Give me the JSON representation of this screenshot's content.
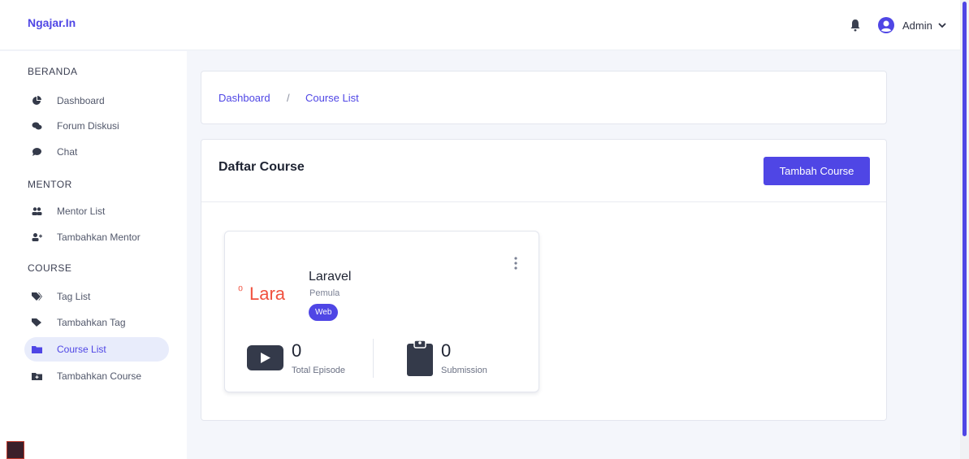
{
  "app": {
    "brand": "Ngajar.In"
  },
  "header": {
    "user_label": "Admin"
  },
  "sidebar": {
    "sections": [
      {
        "title": "BERANDA",
        "items": [
          {
            "label": "Dashboard",
            "icon": "chart-pie-icon"
          },
          {
            "label": "Forum Diskusi",
            "icon": "comments-icon"
          },
          {
            "label": "Chat",
            "icon": "chat-bubble-icon"
          }
        ]
      },
      {
        "title": "MENTOR",
        "items": [
          {
            "label": "Mentor List",
            "icon": "users-icon"
          },
          {
            "label": "Tambahkan Mentor",
            "icon": "user-plus-icon"
          }
        ]
      },
      {
        "title": "COURSE",
        "items": [
          {
            "label": "Tag List",
            "icon": "tags-icon"
          },
          {
            "label": "Tambahkan Tag",
            "icon": "tag-icon"
          },
          {
            "label": "Course List",
            "icon": "folder-icon",
            "active": true
          },
          {
            "label": "Tambahkan Course",
            "icon": "folder-plus-icon"
          }
        ]
      }
    ]
  },
  "breadcrumb": {
    "items": [
      "Dashboard",
      "Course List"
    ],
    "separator": "/"
  },
  "main": {
    "title": "Daftar Course",
    "add_button_label": "Tambah Course",
    "courses": [
      {
        "logo_text": "Lara",
        "logo_mark": "⁰",
        "name": "Laravel",
        "level": "Pemula",
        "tag": "Web",
        "total_episode": "0",
        "total_episode_label": "Total Episode",
        "submission": "0",
        "submission_label": "Submission"
      }
    ]
  },
  "colors": {
    "accent": "#4f46e5",
    "logo": "#f0513f",
    "icon_dark": "#343a4a"
  }
}
